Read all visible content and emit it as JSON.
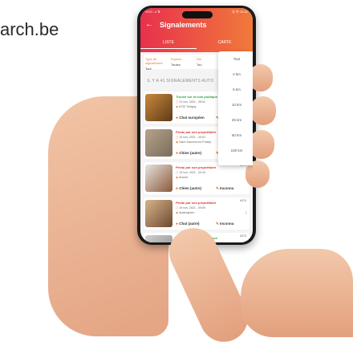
{
  "watermark": "arch.be",
  "status_bar": {
    "left": "VOO ..ıl ⇅",
    "right": "⓪ ▣ 12:41"
  },
  "header": {
    "title": "Signalements",
    "tabs": [
      "LISTE",
      "CARTE"
    ]
  },
  "filters": [
    {
      "label": "Type de signalement",
      "value": "Tout"
    },
    {
      "label": "Espèce",
      "value": "Toutes"
    },
    {
      "label": "Dis",
      "value": "Tou"
    }
  ],
  "count_text": "IL Y A 41 SIGNALEMENTS AUTO",
  "distance_options": [
    "Tout",
    "2 km",
    "5 km",
    "10 km",
    "25 km",
    "50 km",
    "100 km"
  ],
  "cards": [
    {
      "title": "Trouvé sur la voie publique",
      "title_color": "#2e9e3e",
      "date": "22 nov. 2021 - 08:51",
      "place": "6720 Tintigny",
      "type": "Chat européen",
      "age": "Ch",
      "id": "",
      "thumb": [
        "#c98a3b",
        "#5e3a1a"
      ]
    },
    {
      "title": "Perdu par son propriétaire",
      "title_color": "#d8322f",
      "date": "19 nov. 2021 - 20:51",
      "place": "Saint-Sauveur-en-Puisay",
      "type": "Chien (autre)",
      "age": "Ch",
      "id": "",
      "thumb": [
        "#b7a38c",
        "#7a6c5a"
      ]
    },
    {
      "title": "Perdu par son propriétaire",
      "title_color": "#d8322f",
      "date": "19 nov. 2021 - 20:44",
      "place": "Anzeré",
      "type": "Chien (autre)",
      "age": "Inconnu",
      "id": "#375",
      "thumb": [
        "#e7e3de",
        "#8a5a3a"
      ]
    },
    {
      "title": "Perdu par son propriétaire",
      "title_color": "#d8322f",
      "date": "19 nov. 2021 - 09:59",
      "place": "Audenghem",
      "type": "Chat (autre)",
      "age": "Inconnu",
      "id": "#374",
      "thumb": [
        "#d8b48a",
        "#6b4a30"
      ]
    },
    {
      "title": "Trouvé sur la voie publique",
      "title_color": "#2e9e3e",
      "date": "",
      "place": "",
      "type": "",
      "age": "",
      "id": "#373",
      "thumb": [
        "#cfcfcf",
        "#888888"
      ]
    }
  ]
}
